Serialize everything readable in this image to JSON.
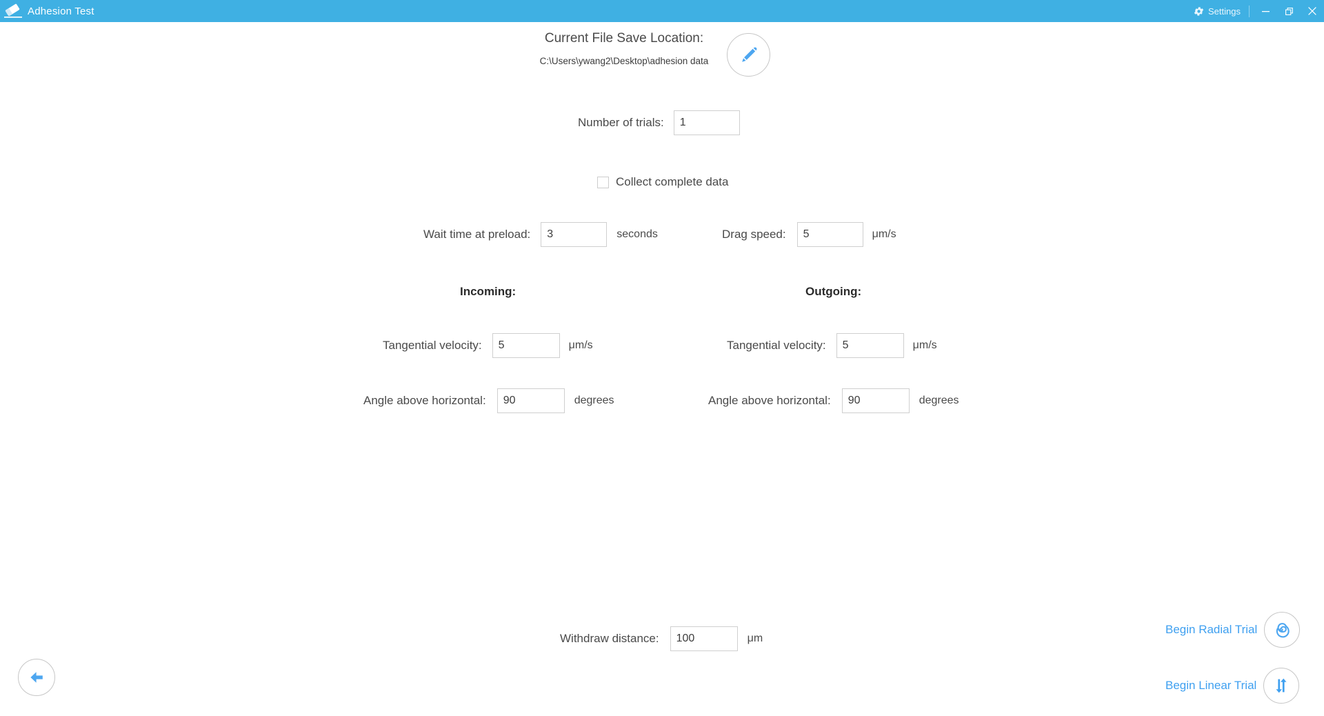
{
  "titlebar": {
    "app_icon": "eraser-icon",
    "title": "Adhesion Test",
    "settings_label": "Settings",
    "settings_icon": "gear-icon",
    "minimize_icon": "minimize-icon",
    "restore_icon": "restore-icon",
    "close_icon": "close-icon",
    "bg_color": "#3fb0e3"
  },
  "save_location": {
    "title": "Current File Save Location:",
    "path": "C:\\Users\\ywang2\\Desktop\\adhesion data",
    "edit_icon": "pencil-icon"
  },
  "form": {
    "trials": {
      "label": "Number of trials:",
      "value": "1"
    },
    "collect": {
      "label": "Collect complete data",
      "checked": false
    },
    "wait": {
      "label": "Wait time at preload:",
      "value": "3",
      "unit": "seconds"
    },
    "drag": {
      "label": "Drag speed:",
      "value": "5",
      "unit": "μm/s"
    },
    "incoming": {
      "header": "Incoming:",
      "tangential": {
        "label": "Tangential velocity:",
        "value": "5",
        "unit": "μm/s"
      },
      "angle": {
        "label": "Angle above horizontal:",
        "value": "90",
        "unit": "degrees"
      }
    },
    "outgoing": {
      "header": "Outgoing:",
      "tangential": {
        "label": "Tangential velocity:",
        "value": "5",
        "unit": "μm/s"
      },
      "angle": {
        "label": "Angle above horizontal:",
        "value": "90",
        "unit": "degrees"
      }
    },
    "withdraw": {
      "label": "Withdraw distance:",
      "value": "100",
      "unit": "μm"
    }
  },
  "actions": {
    "back_icon": "arrow-left-icon",
    "radial": {
      "label": "Begin Radial Trial",
      "icon": "spiral-icon"
    },
    "linear": {
      "label": "Begin Linear Trial",
      "icon": "up-down-arrows-icon"
    }
  },
  "colors": {
    "accent": "#3fb0e3",
    "link": "#3fa0f0",
    "icon_blue": "#4da6f0",
    "border": "#cfcfcf"
  }
}
